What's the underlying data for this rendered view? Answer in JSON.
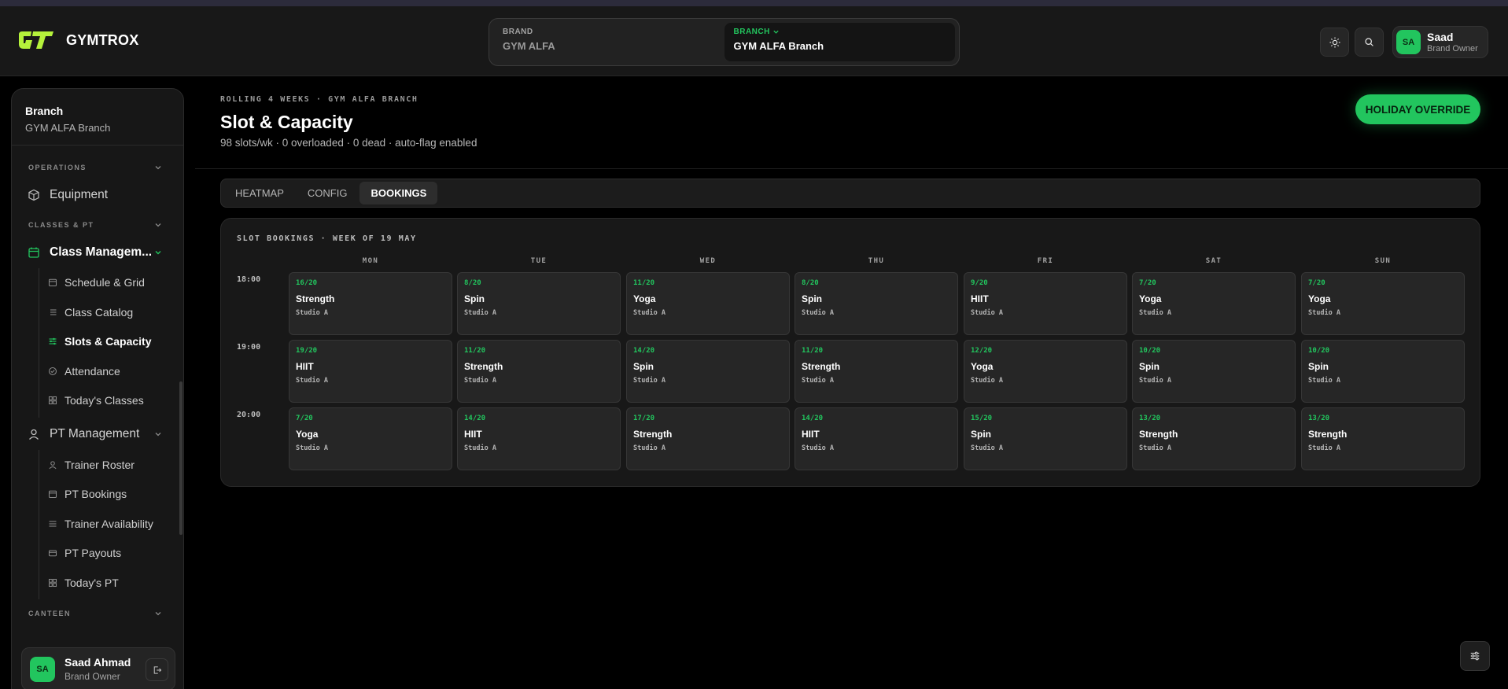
{
  "app": {
    "name": "GYMTROX"
  },
  "switcher": {
    "brand_label": "BRAND",
    "brand_value": "GYM ALFA",
    "branch_label": "BRANCH",
    "branch_value": "GYM ALFA Branch"
  },
  "user": {
    "initials": "SA",
    "name": "Saad",
    "role": "Brand Owner"
  },
  "sidebar": {
    "branch_title": "Branch",
    "branch_value": "GYM ALFA Branch",
    "sections": {
      "operations": "OPERATIONS",
      "classes": "CLASSES & PT",
      "canteen": "CANTEEN"
    },
    "equipment": "Equipment",
    "class_management": "Class Managem...",
    "class_items": [
      "Schedule & Grid",
      "Class Catalog",
      "Slots & Capacity",
      "Attendance",
      "Today's Classes"
    ],
    "pt_management": "PT Management",
    "pt_items": [
      "Trainer Roster",
      "PT Bookings",
      "Trainer Availability",
      "PT Payouts",
      "Today's PT"
    ],
    "footer_user": {
      "initials": "SA",
      "name": "Saad Ahmad",
      "role": "Brand Owner"
    }
  },
  "page": {
    "eyebrow": "ROLLING 4 WEEKS · GYM ALFA BRANCH",
    "title": "Slot & Capacity",
    "subtitle": "98 slots/wk · 0 overloaded · 0 dead · auto-flag enabled",
    "action": "HOLIDAY OVERRIDE"
  },
  "tabs": [
    "HEATMAP",
    "CONFIG",
    "BOOKINGS"
  ],
  "active_tab": "BOOKINGS",
  "bookings": {
    "title": "SLOT BOOKINGS · WEEK OF 19 MAY",
    "days": [
      "MON",
      "TUE",
      "WED",
      "THU",
      "FRI",
      "SAT",
      "SUN"
    ],
    "times": [
      "18:00",
      "19:00",
      "20:00"
    ],
    "rows": [
      [
        {
          "cap": "16/20",
          "cls": "Strength",
          "room": "Studio A"
        },
        {
          "cap": "8/20",
          "cls": "Spin",
          "room": "Studio A"
        },
        {
          "cap": "11/20",
          "cls": "Yoga",
          "room": "Studio A"
        },
        {
          "cap": "8/20",
          "cls": "Spin",
          "room": "Studio A"
        },
        {
          "cap": "9/20",
          "cls": "HIIT",
          "room": "Studio A"
        },
        {
          "cap": "7/20",
          "cls": "Yoga",
          "room": "Studio A"
        },
        {
          "cap": "7/20",
          "cls": "Yoga",
          "room": "Studio A"
        }
      ],
      [
        {
          "cap": "19/20",
          "cls": "HIIT",
          "room": "Studio A"
        },
        {
          "cap": "11/20",
          "cls": "Strength",
          "room": "Studio A"
        },
        {
          "cap": "14/20",
          "cls": "Spin",
          "room": "Studio A"
        },
        {
          "cap": "11/20",
          "cls": "Strength",
          "room": "Studio A"
        },
        {
          "cap": "12/20",
          "cls": "Yoga",
          "room": "Studio A"
        },
        {
          "cap": "10/20",
          "cls": "Spin",
          "room": "Studio A"
        },
        {
          "cap": "10/20",
          "cls": "Spin",
          "room": "Studio A"
        }
      ],
      [
        {
          "cap": "7/20",
          "cls": "Yoga",
          "room": "Studio A"
        },
        {
          "cap": "14/20",
          "cls": "HIIT",
          "room": "Studio A"
        },
        {
          "cap": "17/20",
          "cls": "Strength",
          "room": "Studio A"
        },
        {
          "cap": "14/20",
          "cls": "HIIT",
          "room": "Studio A"
        },
        {
          "cap": "15/20",
          "cls": "Spin",
          "room": "Studio A"
        },
        {
          "cap": "13/20",
          "cls": "Strength",
          "room": "Studio A"
        },
        {
          "cap": "13/20",
          "cls": "Strength",
          "room": "Studio A"
        }
      ]
    ]
  },
  "icons": {
    "theme": "sun-icon",
    "search": "search-icon",
    "logout": "logout-icon",
    "settings": "sliders-icon"
  },
  "colors": {
    "accent": "#22c55e",
    "background": "#000000",
    "surface": "#181818"
  }
}
